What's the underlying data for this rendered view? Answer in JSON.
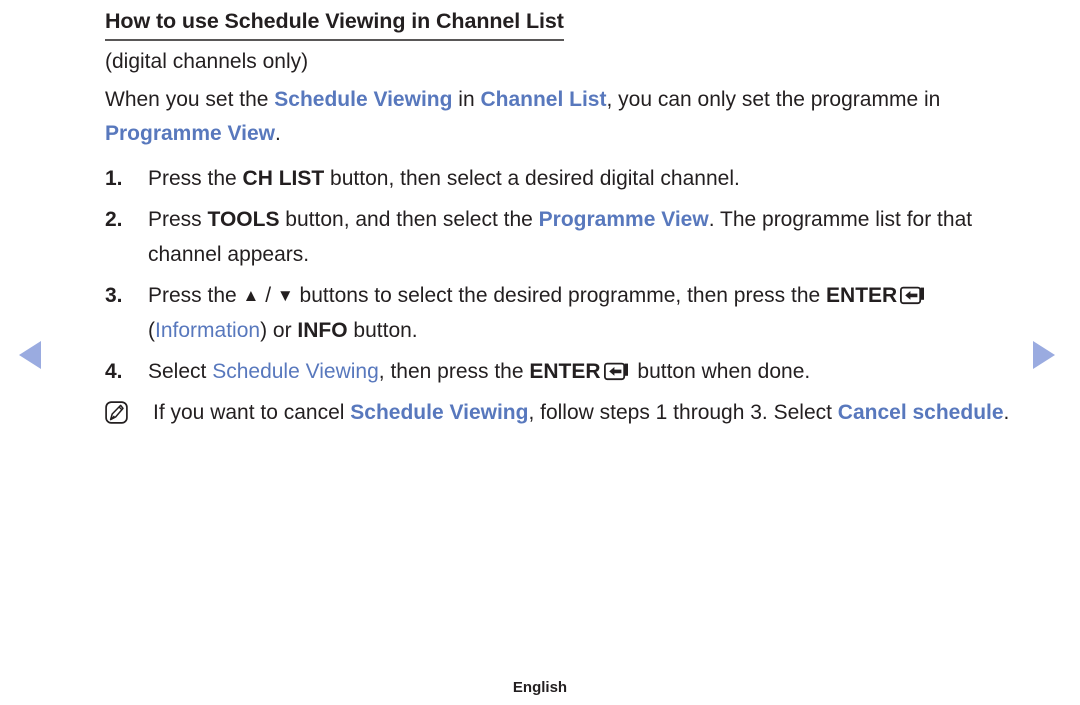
{
  "document": {
    "title": "How to use Schedule Viewing in Channel List",
    "subtitle": "(digital channels only)",
    "intro": {
      "part1": "When you set the ",
      "term1": "Schedule Viewing",
      "part2": " in ",
      "term2": "Channel List",
      "part3": ", you can only set the programme in ",
      "term3": "Programme View",
      "part4": "."
    },
    "steps": [
      {
        "number": "1.",
        "segments": [
          {
            "text": "Press the ",
            "style": "plain"
          },
          {
            "text": "CH LIST",
            "style": "bold"
          },
          {
            "text": " button, then select a desired digital channel.",
            "style": "plain"
          }
        ]
      },
      {
        "number": "2.",
        "segments": [
          {
            "text": "Press ",
            "style": "plain"
          },
          {
            "text": "TOOLS",
            "style": "bold"
          },
          {
            "text": " button, and then select the ",
            "style": "plain"
          },
          {
            "text": "Programme View",
            "style": "highlight"
          },
          {
            "text": ". The programme list for that channel appears.",
            "style": "plain"
          }
        ]
      },
      {
        "number": "3.",
        "segments": [
          {
            "text": "Press the ",
            "style": "plain"
          },
          {
            "text": "▲",
            "style": "glyph"
          },
          {
            "text": " / ",
            "style": "plain"
          },
          {
            "text": "▼",
            "style": "glyph"
          },
          {
            "text": " buttons to select the desired programme, then press the ",
            "style": "plain"
          },
          {
            "text": "ENTER",
            "style": "bold"
          },
          {
            "text": "ENTER_ICON",
            "style": "icon"
          },
          {
            "text": " (",
            "style": "plain"
          },
          {
            "text": "Information",
            "style": "highlight-regular"
          },
          {
            "text": ") or ",
            "style": "plain"
          },
          {
            "text": "INFO",
            "style": "bold"
          },
          {
            "text": " button.",
            "style": "plain"
          }
        ]
      },
      {
        "number": "4.",
        "segments": [
          {
            "text": "Select ",
            "style": "plain"
          },
          {
            "text": "Schedule Viewing",
            "style": "highlight-regular"
          },
          {
            "text": ", then press the ",
            "style": "plain"
          },
          {
            "text": "ENTER",
            "style": "bold"
          },
          {
            "text": "ENTER_ICON",
            "style": "icon"
          },
          {
            "text": " button when done.",
            "style": "plain"
          }
        ]
      }
    ],
    "note": {
      "icon_name": "note-pen-icon",
      "segments": [
        {
          "text": "If you want to cancel ",
          "style": "plain"
        },
        {
          "text": "Schedule Viewing",
          "style": "highlight"
        },
        {
          "text": ", follow steps 1 through 3. Select ",
          "style": "plain"
        },
        {
          "text": "Cancel schedule",
          "style": "highlight"
        },
        {
          "text": ".",
          "style": "plain"
        }
      ]
    },
    "footer": {
      "language": "English"
    },
    "navigation": {
      "previous_page_icon": "triangle-left-icon",
      "next_page_icon": "triangle-right-icon"
    },
    "colors": {
      "highlight_blue": "#5878bd",
      "nav_arrow_blue": "#9aabe0",
      "text_black": "#231f20",
      "rule_gray": "#595757"
    }
  }
}
